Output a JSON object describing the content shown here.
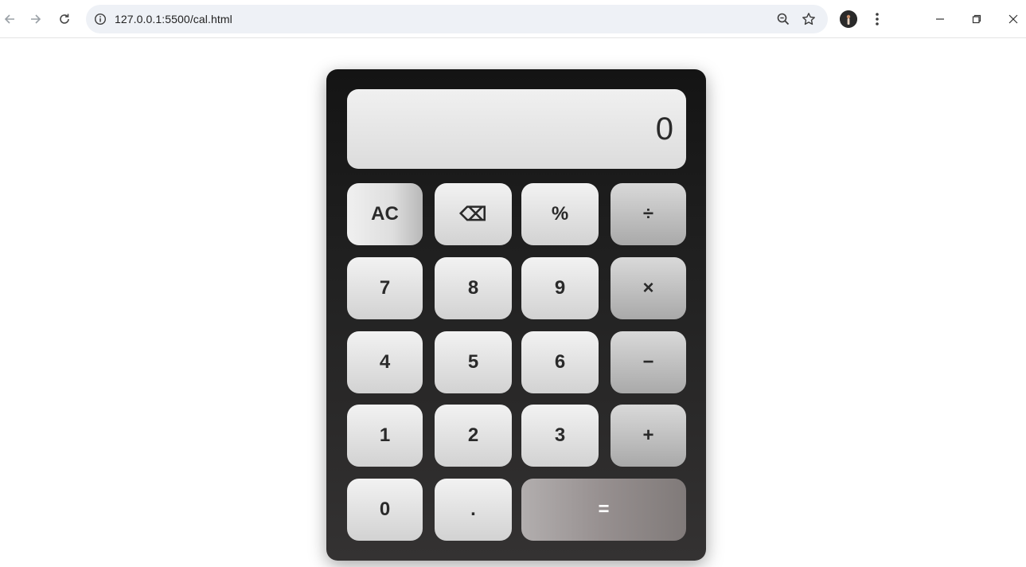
{
  "browser": {
    "url": "127.0.0.1:5500/cal.html",
    "icons": {
      "back": "arrow-left-icon",
      "forward": "arrow-right-icon",
      "reload": "reload-icon",
      "site_info": "info-icon",
      "zoom": "zoom-icon",
      "bookmark": "star-icon",
      "profile": "avatar",
      "menu": "kebab-menu-icon",
      "minimize": "minimize-icon",
      "restore": "restore-icon",
      "close": "close-icon"
    }
  },
  "calculator": {
    "display_value": "0",
    "keys": {
      "ac": "AC",
      "backspace": "⌫",
      "percent": "%",
      "divide": "÷",
      "seven": "7",
      "eight": "8",
      "nine": "9",
      "multiply": "×",
      "four": "4",
      "five": "5",
      "six": "6",
      "minus": "−",
      "one": "1",
      "two": "2",
      "three": "3",
      "plus": "+",
      "zero": "0",
      "decimal": ".",
      "equals": "="
    },
    "colors": {
      "body_top": "#141414",
      "body_bottom": "#343232",
      "key_light": "#f2f2f2",
      "key_operator": "#a9a9a9",
      "equals": "#968f8f"
    }
  }
}
